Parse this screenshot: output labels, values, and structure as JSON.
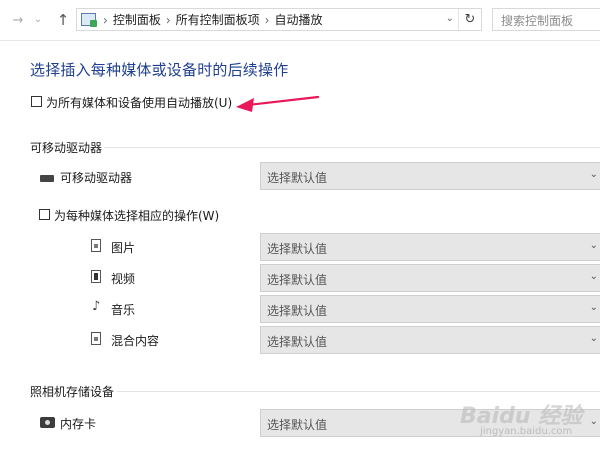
{
  "address_bar": {
    "breadcrumbs": [
      "控制面板",
      "所有控制面板项",
      "自动播放"
    ],
    "search_placeholder": "搜索控制面板"
  },
  "heading": "选择插入每种媒体或设备时的后续操作",
  "autoplay_all": {
    "label": "为所有媒体和设备使用自动播放(U)",
    "checked": false
  },
  "removable_drives": {
    "group_title": "可移动驱动器",
    "item": {
      "label": "可移动驱动器",
      "value": "选择默认值"
    }
  },
  "per_media": {
    "label": "为每种媒体选择相应的操作(W)",
    "checked": false,
    "items": [
      {
        "label": "图片",
        "value": "选择默认值"
      },
      {
        "label": "视频",
        "value": "选择默认值"
      },
      {
        "label": "音乐",
        "value": "选择默认值"
      },
      {
        "label": "混合内容",
        "value": "选择默认值"
      }
    ]
  },
  "camera_storage": {
    "group_title": "照相机存储设备",
    "item": {
      "label": "内存卡",
      "value": "选择默认值"
    }
  },
  "watermark": {
    "brand": "Baidu 经验",
    "url": "jingyan.baidu.com"
  },
  "colors": {
    "accent_heading": "#1f3f8f",
    "annotation_arrow": "#e8185a"
  }
}
